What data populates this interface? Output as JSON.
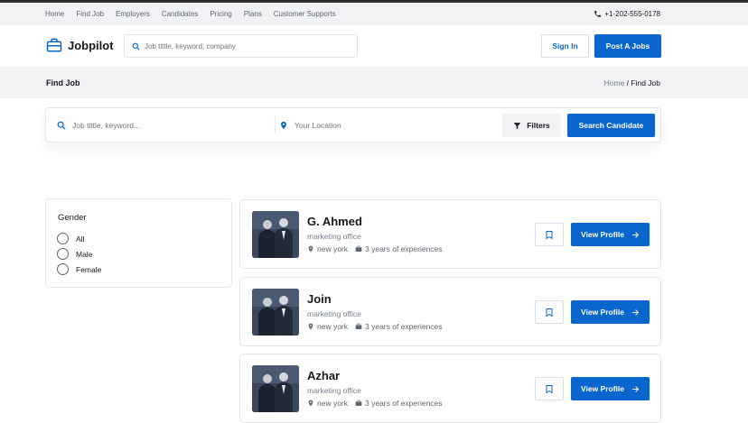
{
  "topnav": {
    "links": [
      "Home",
      "Find Job",
      "Employers",
      "Candidates",
      "Pricing",
      "Plans",
      "Customer Supports"
    ],
    "phone": "+1-202-555-0178"
  },
  "header": {
    "logo_text": "Jobpilot",
    "search_placeholder": "Job tittle, keyword, company",
    "signin_label": "Sign In",
    "post_label": "Post A Jobs"
  },
  "crumbbar": {
    "title": "Find Job",
    "crumb_home": "Home",
    "crumb_sep": " / ",
    "crumb_current": "Find Job"
  },
  "filterbar": {
    "keyword_placeholder": "Job tittle, keyword...",
    "location_placeholder": "Your Location",
    "filters_label": "Filters",
    "search_label": "Search Candidate"
  },
  "sidepanel": {
    "title": "Gender",
    "options": [
      "All",
      "Male",
      "Female"
    ]
  },
  "candidates": [
    {
      "name": "G. Ahmed",
      "role": "marketing office",
      "location": "new york",
      "experience": "3 years of experiences",
      "view_label": "View Profile"
    },
    {
      "name": "Join",
      "role": "marketing office",
      "location": "new york",
      "experience": "3 years of experiences",
      "view_label": "View Profile"
    },
    {
      "name": "Azhar",
      "role": "marketing office",
      "location": "new york",
      "experience": "3 years of experiences",
      "view_label": "View Profile"
    }
  ],
  "colors": {
    "primary": "#0a65cc",
    "muted_bg": "#f1f2f4",
    "border": "#e4e5e8"
  },
  "icons": [
    "phone-icon",
    "briefcase-logo-icon",
    "search-icon",
    "location-pin-icon",
    "filter-icon",
    "bookmark-icon",
    "arrow-right-icon",
    "briefcase-icon"
  ]
}
